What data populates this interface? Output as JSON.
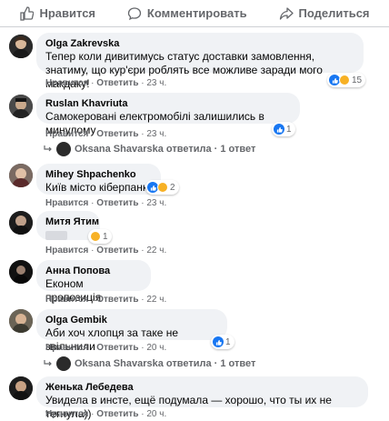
{
  "actions": {
    "like": "Нравится",
    "comment": "Комментировать",
    "share": "Поделиться"
  },
  "comments": [
    {
      "author": "Olga Zakrevska",
      "text": "Тепер коли дивитимусь статус доставки замовлення, знатиму, що кур'єри роблять все можливе заради мого макдаку!",
      "reactions": "15",
      "like": "Нравится",
      "reply": "Ответить",
      "time": "23 ч."
    },
    {
      "author": "Ruslan Khavriuta",
      "text": "Самокеровані електромобілі залишились в минулому",
      "reactions": "1",
      "like": "Нравится",
      "reply": "Ответить",
      "time": "23 ч.",
      "thread": "Oksana Shavarska ответила · 1 ответ"
    },
    {
      "author": "Mihey Shpachenko",
      "text": "Київ місто кіберпанк",
      "reactions": "2",
      "like": "Нравится",
      "reply": "Ответить",
      "time": "23 ч."
    },
    {
      "author": "Митя Ятим",
      "reactions": "1",
      "like": "Нравится",
      "reply": "Ответить",
      "time": "22 ч."
    },
    {
      "author": "Анна Попова",
      "text": "Економ пропозиція",
      "like": "Нравится",
      "reply": "Ответить",
      "time": "22 ч."
    },
    {
      "author": "Olga Gembik",
      "text": "Аби хоч хлопця за таке не звільнили",
      "reactions": "1",
      "like": "Нравится",
      "reply": "Ответить",
      "time": "20 ч.",
      "thread": "Oksana Shavarska ответила · 1 ответ"
    },
    {
      "author": "Женька Лебедева",
      "text": "Увидела в инсте, ещё подумала — хорошо, что ты их не тегнула))",
      "like": "Нравится",
      "reply": "Ответить",
      "time": "20 ч."
    }
  ],
  "colors": {
    "like_blue": "#1877f2",
    "haha_yellow": "#f7b125",
    "bubble_bg": "#f0f2f5",
    "meta_gray": "#65676b"
  }
}
